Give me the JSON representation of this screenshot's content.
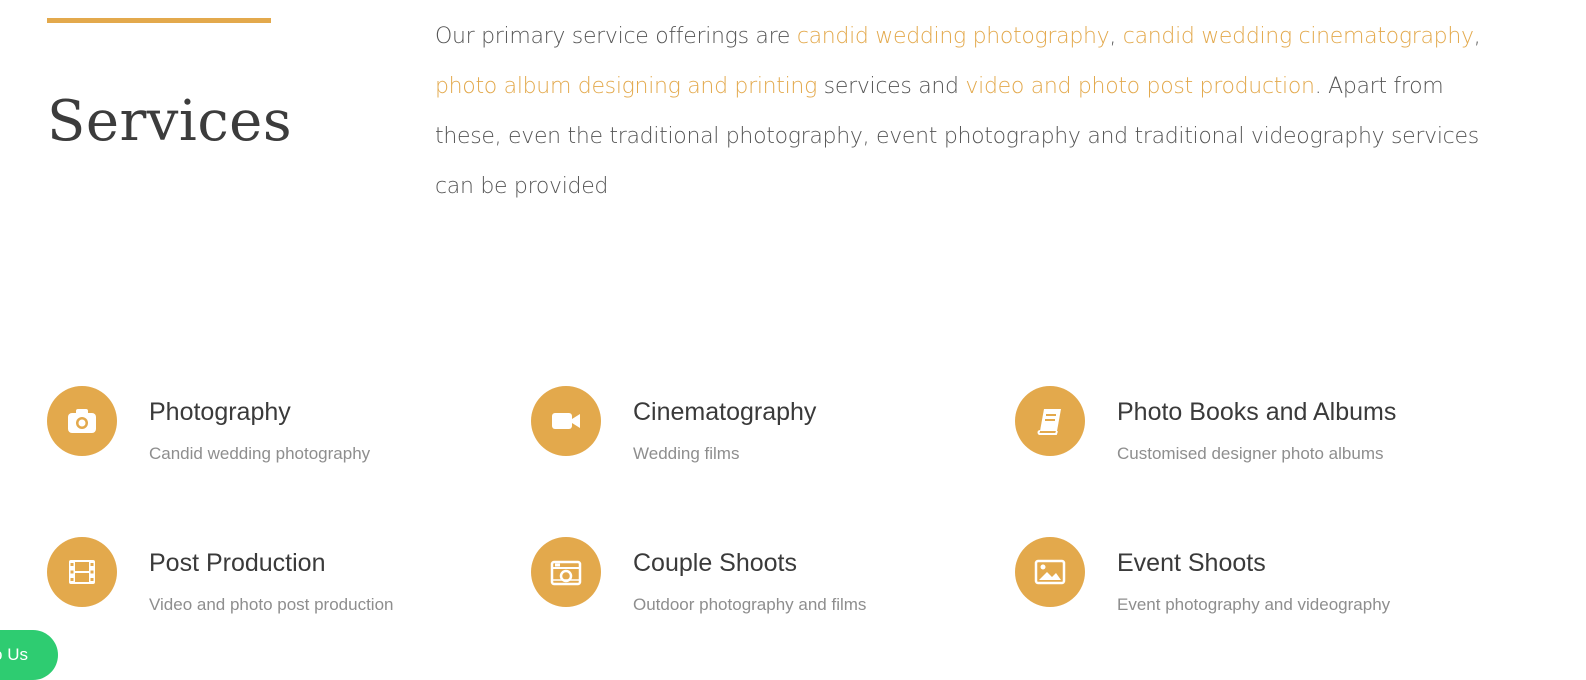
{
  "section": {
    "title": "Services",
    "accent_color": "#e3a94c"
  },
  "intro": {
    "prefix": "Our primary service offerings are ",
    "link1": "candid wedding photography",
    "sep1": ", ",
    "link2": "candid wedding cinematography",
    "sep2": ", ",
    "link3": "photo album designing and printing",
    "mid": " services and ",
    "link4": "video and photo post production",
    "suffix": ". Apart from these, even the traditional photography, event photography and traditional videography services can be provided"
  },
  "services": [
    {
      "icon": "camera-icon",
      "title": "Photography",
      "desc": "Candid wedding photography"
    },
    {
      "icon": "video-camera-icon",
      "title": "Cinematography",
      "desc": "Wedding films"
    },
    {
      "icon": "book-icon",
      "title": "Photo Books and Albums",
      "desc": "Customised designer photo albums"
    },
    {
      "icon": "film-icon",
      "title": "Post Production",
      "desc": "Video and photo post production"
    },
    {
      "icon": "polaroid-camera-icon",
      "title": "Couple Shoots",
      "desc": "Outdoor photography and films"
    },
    {
      "icon": "image-icon",
      "title": "Event Shoots",
      "desc": "Event photography and videography"
    }
  ],
  "floating_button": {
    "label": "o Us",
    "color": "#2ecc71"
  }
}
